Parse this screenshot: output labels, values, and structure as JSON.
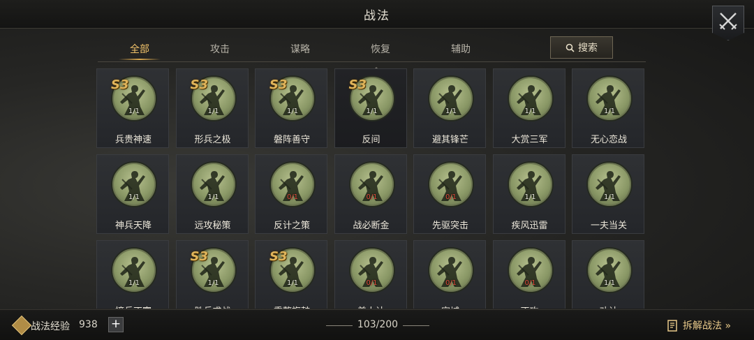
{
  "header": {
    "title": "战法"
  },
  "tabs": [
    {
      "label": "全部",
      "active": true
    },
    {
      "label": "攻击",
      "active": false
    },
    {
      "label": "谋略",
      "active": false
    },
    {
      "label": "恢复",
      "active": false
    },
    {
      "label": "辅助",
      "active": false
    }
  ],
  "search": {
    "label": "搜索"
  },
  "skills": [
    {
      "name": "兵贵神速",
      "count": "1/1",
      "grade": "S3",
      "count_state": "ok"
    },
    {
      "name": "形兵之极",
      "count": "1/1",
      "grade": "S3",
      "count_state": "ok"
    },
    {
      "name": "磐阵善守",
      "count": "1/1",
      "grade": "S3",
      "count_state": "ok"
    },
    {
      "name": "反间",
      "count": "1/1",
      "grade": "S3",
      "count_state": "ok",
      "selected": true
    },
    {
      "name": "避其锋芒",
      "count": "1/1",
      "grade": "",
      "count_state": "ok"
    },
    {
      "name": "大赏三军",
      "count": "1/1",
      "grade": "",
      "count_state": "ok"
    },
    {
      "name": "无心恋战",
      "count": "1/1",
      "grade": "",
      "count_state": "ok"
    },
    {
      "name": "神兵天降",
      "count": "1/1",
      "grade": "",
      "count_state": "ok"
    },
    {
      "name": "远攻秘策",
      "count": "1/1",
      "grade": "",
      "count_state": "ok"
    },
    {
      "name": "反计之策",
      "count": "0/1",
      "grade": "",
      "count_state": "empty"
    },
    {
      "name": "战必断金",
      "count": "0/1",
      "grade": "",
      "count_state": "empty"
    },
    {
      "name": "先驱突击",
      "count": "0/1",
      "grade": "",
      "count_state": "empty"
    },
    {
      "name": "疾风迅雷",
      "count": "1/1",
      "grade": "",
      "count_state": "ok"
    },
    {
      "name": "一夫当关",
      "count": "1/1",
      "grade": "",
      "count_state": "ok"
    },
    {
      "name": "摘兵不寡",
      "count": "1/1",
      "grade": "",
      "count_state": "ok"
    },
    {
      "name": "胜兵求战",
      "count": "1/1",
      "grade": "S3",
      "count_state": "ok"
    },
    {
      "name": "重整旗鼓",
      "count": "1/1",
      "grade": "S3",
      "count_state": "ok"
    },
    {
      "name": "美人计",
      "count": "0/1",
      "grade": "",
      "count_state": "empty"
    },
    {
      "name": "空城",
      "count": "0/1",
      "grade": "",
      "count_state": "empty"
    },
    {
      "name": "不攻",
      "count": "0/1",
      "grade": "",
      "count_state": "empty"
    },
    {
      "name": "劝计",
      "count": "1/1",
      "grade": "",
      "count_state": "ok"
    }
  ],
  "footer": {
    "exp_label": "战法经验",
    "exp_value": "938",
    "plus": "+",
    "page": "103/200",
    "disassemble_label": "拆解战法 »"
  },
  "colors": {
    "accent": "#f1c26a",
    "empty_count": "#e04a3a"
  }
}
